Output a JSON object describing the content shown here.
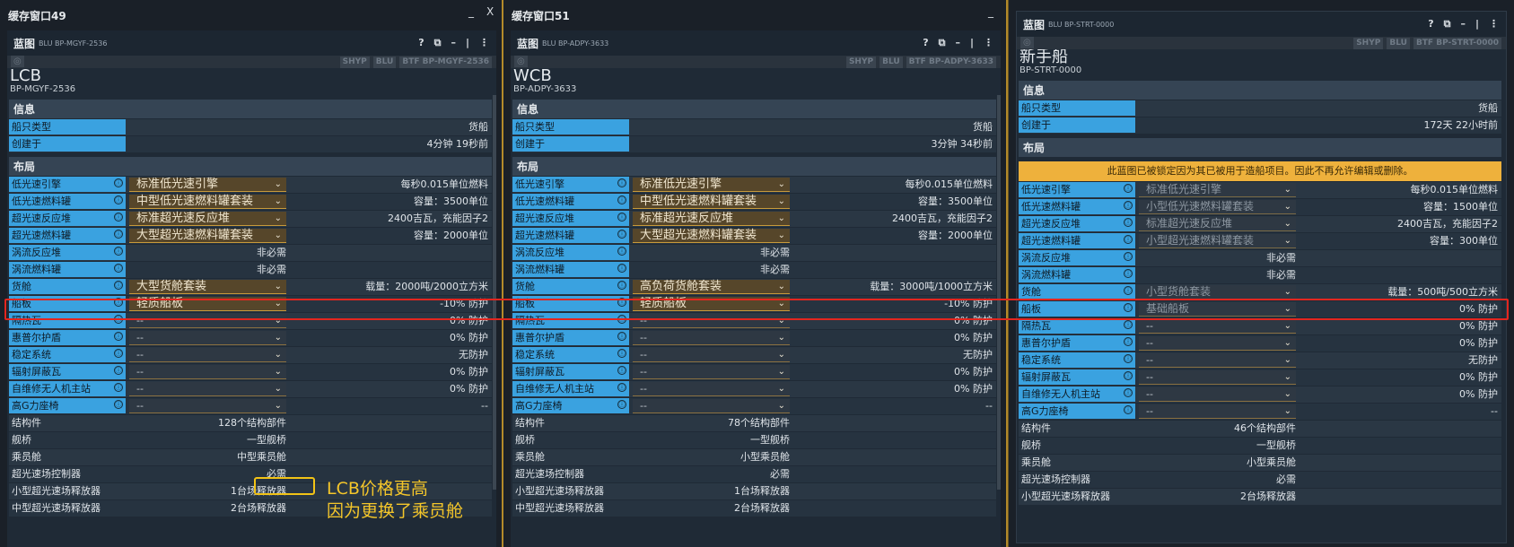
{
  "windows": [
    {
      "id": "w1",
      "title": "缓存窗口49",
      "ctrl_min": "_",
      "ctrl_close": "X",
      "panel_tag": "蓝图",
      "panel_sub": "BLU BP-MGYF-2536",
      "tags": [
        "SHYP",
        "BLU",
        "BTF BP-MGYF-2536"
      ],
      "name": "LCB",
      "code": "BP-MGYF-2536",
      "info_header": "信息",
      "info": [
        {
          "label": "船只类型",
          "value": "货船"
        },
        {
          "label": "创建于",
          "value": "4分钟 19秒前"
        }
      ],
      "layout_header": "布局",
      "rows": [
        {
          "label": "低光速引擎",
          "select": "标准低光速引擎",
          "value": "每秒0.015单位燃料"
        },
        {
          "label": "低光速燃料罐",
          "select": "中型低光速燃料罐套装",
          "value": "容量：3500单位"
        },
        {
          "label": "超光速反应堆",
          "select": "标准超光速反应堆",
          "value": "2400吉瓦，充能因子2"
        },
        {
          "label": "超光速燃料罐",
          "select": "大型超光速燃料罐套装",
          "value": "容量：2000单位"
        },
        {
          "label": "涡流反应堆",
          "mid": "非必需"
        },
        {
          "label": "涡流燃料罐",
          "mid": "非必需"
        },
        {
          "label": "货舱",
          "select": "大型货舱套装",
          "value": "载量：2000吨/2000立方米"
        },
        {
          "label": "船板",
          "select": "轻质船板",
          "value": "-10% 防护"
        },
        {
          "label": "隔热瓦",
          "select": "--",
          "empty": true,
          "value": "0% 防护"
        },
        {
          "label": "惠普尔护盾",
          "select": "--",
          "empty": true,
          "value": "0% 防护"
        },
        {
          "label": "稳定系统",
          "select": "--",
          "empty": true,
          "value": "无防护"
        },
        {
          "label": "辐射屏蔽瓦",
          "select": "--",
          "empty": true,
          "value": "0% 防护"
        },
        {
          "label": "自维修无人机主站",
          "select": "--",
          "empty": true,
          "value": "0% 防护"
        },
        {
          "label": "高G力座椅",
          "select": "--",
          "empty": true,
          "value": "--"
        }
      ],
      "plain_rows": [
        {
          "label": "结构件",
          "mid": "128个结构部件"
        },
        {
          "label": "舰桥",
          "mid": "一型舰桥"
        },
        {
          "label": "乘员舱",
          "mid": "中型乘员舱"
        },
        {
          "label": "超光速场控制器",
          "mid": "必需"
        },
        {
          "label": "小型超光速场释放器",
          "mid": "1台场释放器"
        },
        {
          "label": "中型超光速场释放器",
          "mid": "2台场释放器"
        }
      ]
    },
    {
      "id": "w2",
      "title": "缓存窗口51",
      "ctrl_min": "_",
      "ctrl_close": "X",
      "panel_tag": "蓝图",
      "panel_sub": "BLU BP-ADPY-3633",
      "tags": [
        "SHYP",
        "BLU",
        "BTF BP-ADPY-3633"
      ],
      "name": "WCB",
      "code": "BP-ADPY-3633",
      "info_header": "信息",
      "info": [
        {
          "label": "船只类型",
          "value": "货船"
        },
        {
          "label": "创建于",
          "value": "3分钟 34秒前"
        }
      ],
      "layout_header": "布局",
      "rows": [
        {
          "label": "低光速引擎",
          "select": "标准低光速引擎",
          "value": "每秒0.015单位燃料"
        },
        {
          "label": "低光速燃料罐",
          "select": "中型低光速燃料罐套装",
          "value": "容量：3500单位"
        },
        {
          "label": "超光速反应堆",
          "select": "标准超光速反应堆",
          "value": "2400吉瓦，充能因子2"
        },
        {
          "label": "超光速燃料罐",
          "select": "大型超光速燃料罐套装",
          "value": "容量：2000单位"
        },
        {
          "label": "涡流反应堆",
          "mid": "非必需"
        },
        {
          "label": "涡流燃料罐",
          "mid": "非必需"
        },
        {
          "label": "货舱",
          "select": "高负荷货舱套装",
          "value": "载量：3000吨/1000立方米"
        },
        {
          "label": "船板",
          "select": "轻质船板",
          "value": "-10% 防护"
        },
        {
          "label": "隔热瓦",
          "select": "--",
          "empty": true,
          "value": "0% 防护"
        },
        {
          "label": "惠普尔护盾",
          "select": "--",
          "empty": true,
          "value": "0% 防护"
        },
        {
          "label": "稳定系统",
          "select": "--",
          "empty": true,
          "value": "无防护"
        },
        {
          "label": "辐射屏蔽瓦",
          "select": "--",
          "empty": true,
          "value": "0% 防护"
        },
        {
          "label": "自维修无人机主站",
          "select": "--",
          "empty": true,
          "value": "0% 防护"
        },
        {
          "label": "高G力座椅",
          "select": "--",
          "empty": true,
          "value": "--"
        }
      ],
      "plain_rows": [
        {
          "label": "结构件",
          "mid": "78个结构部件"
        },
        {
          "label": "舰桥",
          "mid": "一型舰桥"
        },
        {
          "label": "乘员舱",
          "mid": "小型乘员舱"
        },
        {
          "label": "超光速场控制器",
          "mid": "必需"
        },
        {
          "label": "小型超光速场释放器",
          "mid": "1台场释放器"
        },
        {
          "label": "中型超光速场释放器",
          "mid": "2台场释放器"
        }
      ]
    },
    {
      "id": "w3",
      "panel_tag": "蓝图",
      "panel_sub": "BLU BP-STRT-0000",
      "tags": [
        "SHYP",
        "BLU",
        "BTF BP-STRT-0000"
      ],
      "name": "新手船",
      "code": "BP-STRT-0000",
      "info_header": "信息",
      "info": [
        {
          "label": "船只类型",
          "value": "货船"
        },
        {
          "label": "创建于",
          "value": "172天 22小时前"
        }
      ],
      "layout_header": "布局",
      "lock_msg": "此蓝图已被锁定因为其已被用于造船项目。因此不再允许编辑或删除。",
      "rows": [
        {
          "label": "低光速引擎",
          "select": "标准低光速引擎",
          "dis": true,
          "value": "每秒0.015单位燃料"
        },
        {
          "label": "低光速燃料罐",
          "select": "小型低光速燃料罐套装",
          "dis": true,
          "value": "容量：1500单位"
        },
        {
          "label": "超光速反应堆",
          "select": "标准超光速反应堆",
          "dis": true,
          "value": "2400吉瓦，充能因子2"
        },
        {
          "label": "超光速燃料罐",
          "select": "小型超光速燃料罐套装",
          "dis": true,
          "value": "容量：300单位"
        },
        {
          "label": "涡流反应堆",
          "mid": "非必需"
        },
        {
          "label": "涡流燃料罐",
          "mid": "非必需"
        },
        {
          "label": "货舱",
          "select": "小型货舱套装",
          "dis": true,
          "value": "载量：500吨/500立方米"
        },
        {
          "label": "船板",
          "select": "基础船板",
          "dis": true,
          "value": "0% 防护"
        },
        {
          "label": "隔热瓦",
          "select": "--",
          "empty": true,
          "value": "0% 防护"
        },
        {
          "label": "惠普尔护盾",
          "select": "--",
          "empty": true,
          "value": "0% 防护"
        },
        {
          "label": "稳定系统",
          "select": "--",
          "empty": true,
          "value": "无防护"
        },
        {
          "label": "辐射屏蔽瓦",
          "select": "--",
          "empty": true,
          "value": "0% 防护"
        },
        {
          "label": "自维修无人机主站",
          "select": "--",
          "empty": true,
          "value": "0% 防护"
        },
        {
          "label": "高G力座椅",
          "select": "--",
          "empty": true,
          "value": "--"
        }
      ],
      "plain_rows": [
        {
          "label": "结构件",
          "mid": "46个结构部件"
        },
        {
          "label": "舰桥",
          "mid": "一型舰桥"
        },
        {
          "label": "乘员舱",
          "mid": "小型乘员舱"
        },
        {
          "label": "超光速场控制器",
          "mid": "必需"
        },
        {
          "label": "小型超光速场释放器",
          "mid": "2台场释放器"
        }
      ]
    }
  ],
  "panel_ctrls": [
    "?",
    "⧉",
    "–",
    "|",
    "⋮"
  ],
  "info_icon": "ⓘ",
  "annotation": {
    "line1": "LCB价格更高",
    "line2": "因为更换了乘员舱"
  },
  "colors": {
    "label_bg": "#3aa2e0",
    "highlight_red": "#e3261f",
    "highlight_yellow": "#f2c316",
    "lock_bg": "#eeb13c"
  }
}
